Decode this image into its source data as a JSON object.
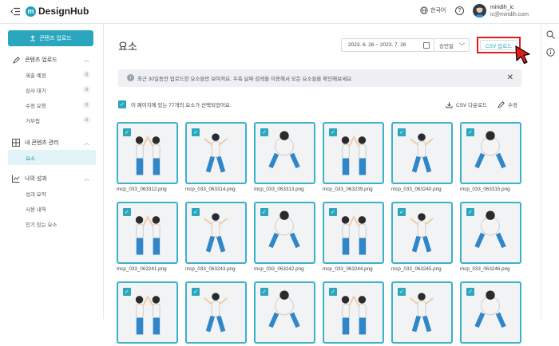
{
  "header": {
    "app_name": "DesignHub",
    "logo_letter": "m",
    "language": "한국어",
    "help_symbol": "?",
    "user_name": "miridih_ic",
    "user_email": "ic@miridih.com"
  },
  "sidebar": {
    "upload_label": "콘텐츠 업로드",
    "sections": [
      {
        "label": "콘텐츠 업로드",
        "icon": "pencil-icon",
        "items": [
          {
            "label": "제출 예정",
            "count": "0"
          },
          {
            "label": "심사 대기",
            "count": "0"
          },
          {
            "label": "수정 요청",
            "count": "0"
          },
          {
            "label": "거부됨",
            "count": "0"
          }
        ]
      },
      {
        "label": "내 콘텐츠 관리",
        "icon": "grid-icon",
        "items": [
          {
            "label": "요소",
            "active": true
          }
        ]
      },
      {
        "label": "나의 성과",
        "icon": "chart-icon",
        "items": [
          {
            "label": "성과 요약"
          },
          {
            "label": "사용 내역"
          },
          {
            "label": "인기 있는 요소"
          }
        ]
      }
    ]
  },
  "main": {
    "title": "요소",
    "date_range": "2023. 6. 26 ~ 2023. 7. 26",
    "sort_value": "승인일",
    "csv_upload_label": "CSV 업로드",
    "notice": "최근 30일동안 업로드한 요소들만 보여져요. 우측 날짜 검색을 이용해서 모든 요소들을 확인해보세요",
    "selection_text": "이 페이지에 있는 77개의 요소가 선택되었어요.",
    "csv_download_label": "CSV 다운로드",
    "edit_label": "수정",
    "files": [
      "mcp_033_063312.png",
      "mcp_033_063314.png",
      "mcp_033_063313.png",
      "mcp_033_063239.png",
      "mcp_033_063240.png",
      "mcp_033_063315.png",
      "mcp_033_063241.png",
      "mcp_033_063243.png",
      "mcp_033_063242.png",
      "mcp_033_063244.png",
      "mcp_033_063245.png",
      "mcp_033_063246.png",
      "",
      "",
      "",
      "",
      "",
      ""
    ]
  },
  "colors": {
    "accent": "#2aa6bf",
    "highlight": "#e31b1b"
  }
}
